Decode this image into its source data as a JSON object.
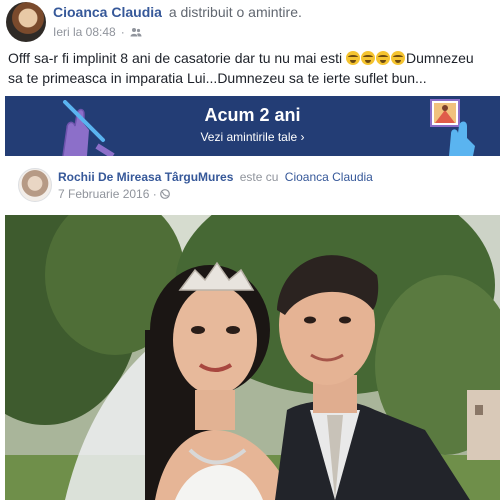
{
  "post": {
    "author_name": "Cioanca Claudia",
    "action": "a distribuit o amintire.",
    "time": "Ieri la 08:48",
    "separator": "·",
    "privacy_icon": "friends-icon",
    "text_line1": "Offf sa-r fi implinit 8 ani de casatorie dar tu nu mai esti",
    "text_line1_end": "Dumnezeu",
    "text_line2": "sa te primeasca in imparatia Lui...Dumnezeu sa te ierte suflet bun...",
    "emoji_icon": "crying-face-emoji",
    "emoji_count": 4
  },
  "memories": {
    "title": "Acum 2 ani",
    "link": "Vezi amintirile tale ›",
    "background": "#233d75"
  },
  "shared": {
    "page_name": "Rochii De Mireasa TârguMures",
    "with_text": "este cu",
    "tagged": "Cioanca Claudia",
    "date": "7 Februarie 2016",
    "separator": "·",
    "privacy_icon": "globe-icon"
  },
  "colors": {
    "link_blue": "#365899",
    "meta_gray": "#90949c",
    "text": "#1d2129"
  }
}
